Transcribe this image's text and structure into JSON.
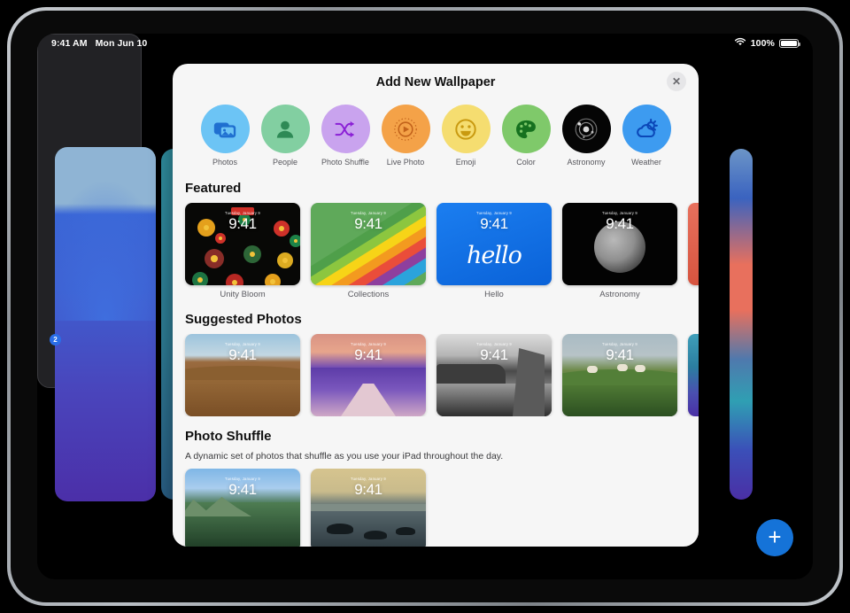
{
  "statusbar": {
    "time": "9:41 AM",
    "date": "Mon Jun 10",
    "wifi_icon": "wifi-icon",
    "battery_percent": "100%",
    "battery_icon": "battery-icon"
  },
  "marker": {
    "label": "2"
  },
  "fab": {
    "label": "+",
    "icon": "plus-icon",
    "color": "#1573d8"
  },
  "sheet": {
    "title": "Add New Wallpaper",
    "close_label": "✕",
    "close_icon": "close-icon"
  },
  "categories": [
    {
      "label": "Photos",
      "icon": "photos-icon",
      "bg": "#6cc4f5",
      "fg": "#1f6fd0"
    },
    {
      "label": "People",
      "icon": "person-icon",
      "bg": "#82cfa1",
      "fg": "#2e8a56"
    },
    {
      "label": "Photo Shuffle",
      "icon": "shuffle-icon",
      "bg": "#c9a3ee",
      "fg": "#8b1fd6"
    },
    {
      "label": "Live Photo",
      "icon": "live-photo-icon",
      "bg": "#f4a248",
      "fg": "#c2621a"
    },
    {
      "label": "Emoji",
      "icon": "emoji-smile-icon",
      "bg": "#f5dd70",
      "fg": "#c99a10"
    },
    {
      "label": "Color",
      "icon": "color-palette-icon",
      "bg": "#7fc96a",
      "fg": "#16711f"
    },
    {
      "label": "Astronomy",
      "icon": "astronomy-icon",
      "bg": "#050505",
      "fg": "#c9c9c9"
    },
    {
      "label": "Weather",
      "icon": "weather-icon",
      "bg": "#3d9bf0",
      "fg": "#0b47b8"
    }
  ],
  "sections": [
    {
      "title": "Featured",
      "subtitle": "",
      "items": [
        {
          "label": "Unity Bloom",
          "time": "9:41",
          "date": "Tuesday, January 9",
          "art": "art-unity"
        },
        {
          "label": "Collections",
          "time": "9:41",
          "date": "Tuesday, January 9",
          "art": "art-collections"
        },
        {
          "label": "Hello",
          "time": "9:41",
          "date": "Tuesday, January 9",
          "art": "art-hello"
        },
        {
          "label": "Astronomy",
          "time": "9:41",
          "date": "Tuesday, January 9",
          "art": "art-astro"
        }
      ]
    },
    {
      "title": "Suggested Photos",
      "subtitle": "",
      "items": [
        {
          "label": "",
          "time": "9:41",
          "date": "Tuesday, January 9",
          "art": "art-field"
        },
        {
          "label": "",
          "time": "9:41",
          "date": "Tuesday, January 9",
          "art": "art-canyon"
        },
        {
          "label": "",
          "time": "9:41",
          "date": "Tuesday, January 9",
          "art": "art-bw"
        },
        {
          "label": "",
          "time": "9:41",
          "date": "Tuesday, January 9",
          "art": "art-sheep"
        }
      ]
    },
    {
      "title": "Photo Shuffle",
      "subtitle": "A dynamic set of photos that shuffle as you use your iPad throughout the day.",
      "items": [
        {
          "label": "",
          "time": "9:41",
          "date": "Tuesday, January 9",
          "art": "art-mtn"
        },
        {
          "label": "",
          "time": "9:41",
          "date": "Tuesday, January 9",
          "art": "art-lake"
        }
      ]
    }
  ]
}
